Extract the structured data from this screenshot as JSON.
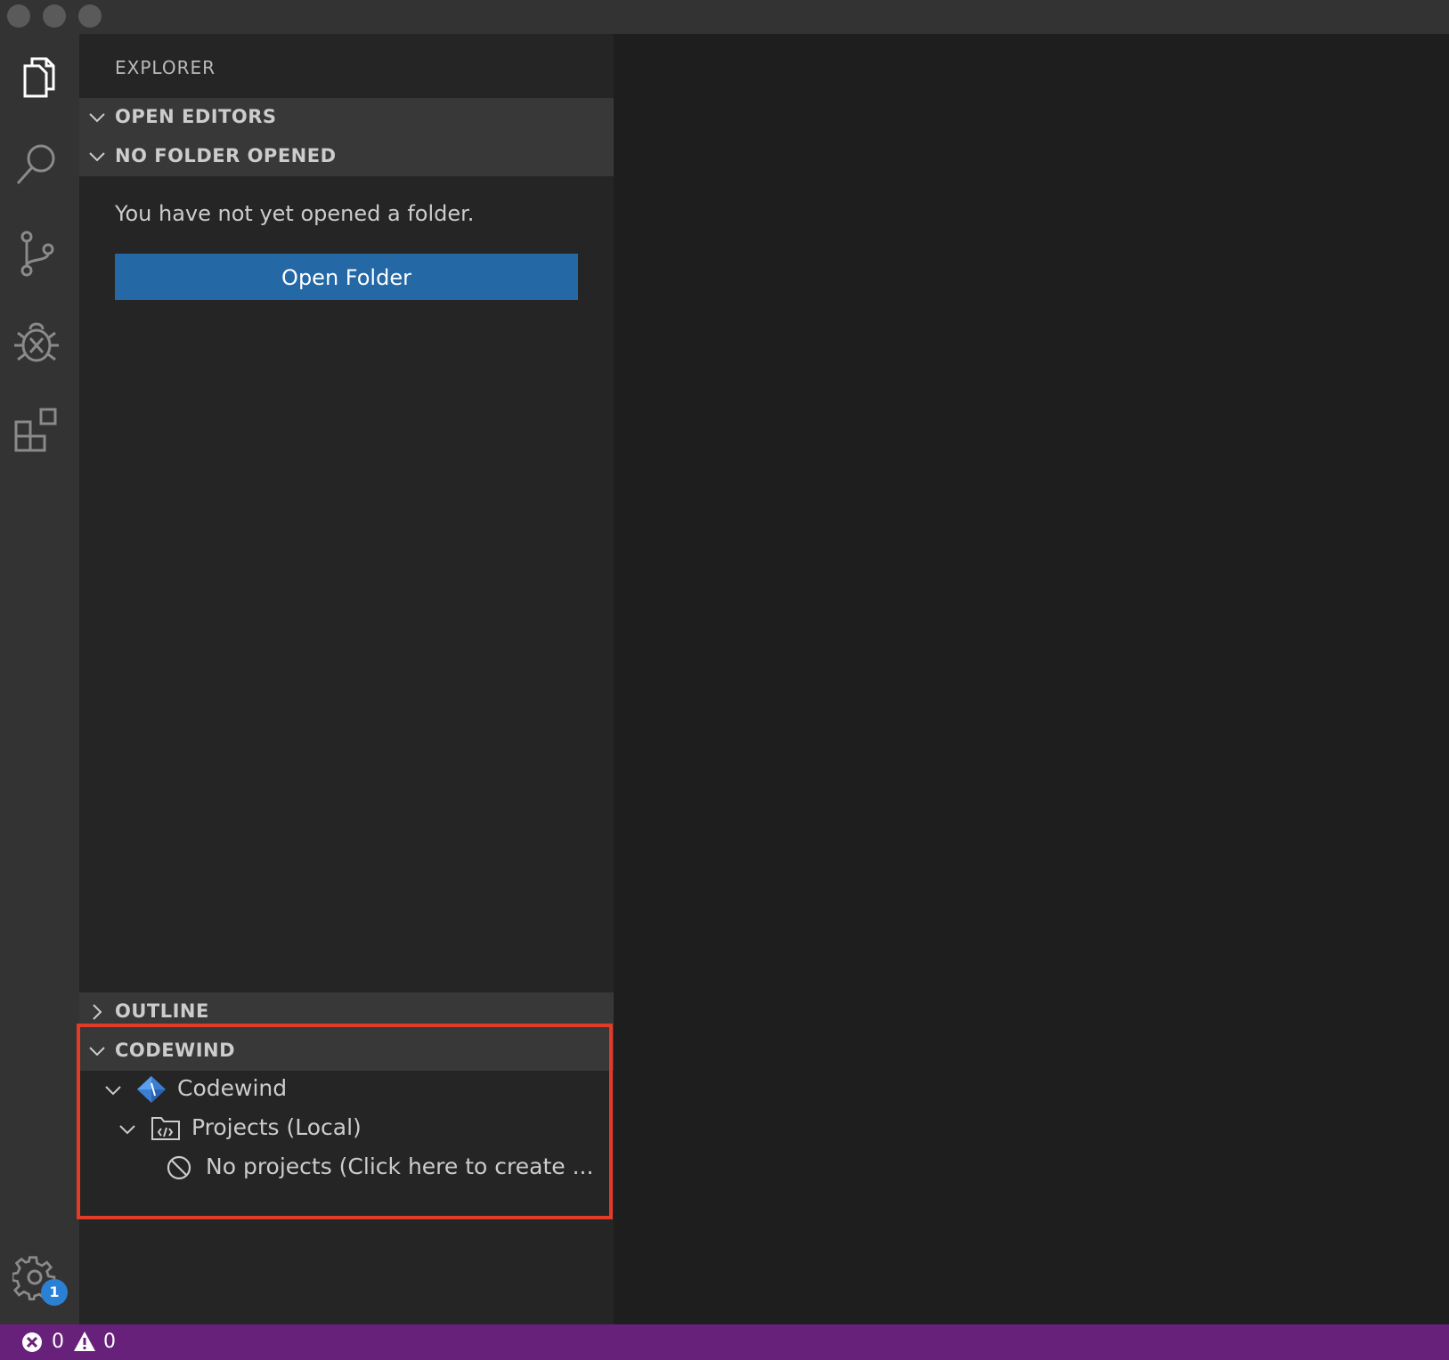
{
  "activity_bar": {
    "icons": [
      "files-icon",
      "search-icon",
      "source-control-icon",
      "debug-icon",
      "extensions-icon"
    ],
    "settings_badge": "1"
  },
  "sidebar": {
    "title": "EXPLORER",
    "sections": {
      "open_editors": "OPEN EDITORS",
      "no_folder": "NO FOLDER OPENED",
      "outline": "OUTLINE",
      "codewind": "CODEWIND"
    },
    "empty_message": "You have not yet opened a folder.",
    "open_folder_label": "Open Folder"
  },
  "codewind_tree": {
    "root_label": "Codewind",
    "projects_label": "Projects (Local)",
    "no_projects_label": "No projects (Click here to create ..."
  },
  "statusbar": {
    "errors": "0",
    "warnings": "0"
  },
  "colors": {
    "accent_button": "#2468a5",
    "statusbar": "#68217a",
    "highlight": "#e23b28",
    "codewind_brand": "#3b7fd4"
  }
}
